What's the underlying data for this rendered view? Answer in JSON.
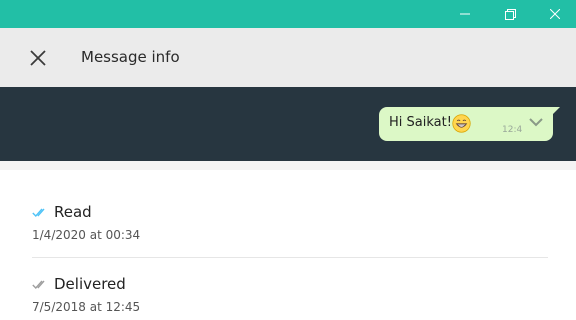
{
  "window": {
    "controls": [
      "minimize",
      "maximize",
      "close"
    ],
    "accent_color": "#22bfa6"
  },
  "header": {
    "close_icon": "close-icon",
    "title": "Message info"
  },
  "message": {
    "text": "Hi Saikat!",
    "emoji": "grinning-face-emoji",
    "time": "12:4",
    "menu_icon": "chevron-down-icon",
    "bubble_color": "#dcf8c6",
    "band_color": "#273640"
  },
  "statuses": [
    {
      "label": "Read",
      "timestamp": "1/4/2020 at 00:34",
      "icon": "double-check-blue-icon",
      "icon_color": "#4fc3f7"
    },
    {
      "label": "Delivered",
      "timestamp": "7/5/2018 at 12:45",
      "icon": "double-check-grey-icon",
      "icon_color": "#9e9e9e"
    }
  ]
}
